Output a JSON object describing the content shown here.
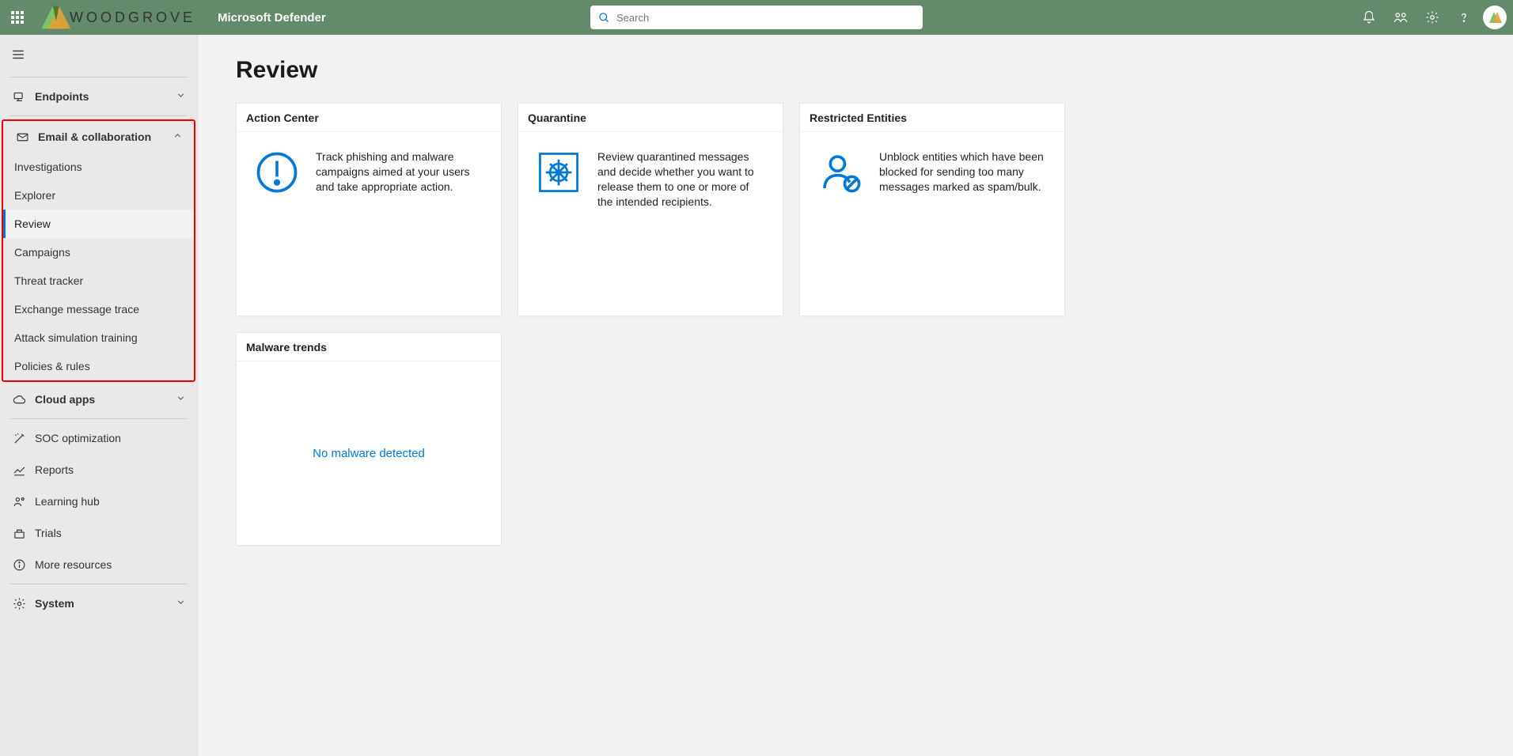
{
  "header": {
    "org": "WOODGROVE",
    "product": "Microsoft Defender",
    "search_placeholder": "Search"
  },
  "sidebar": {
    "endpoints": "Endpoints",
    "email_collab": "Email & collaboration",
    "sub": {
      "investigations": "Investigations",
      "explorer": "Explorer",
      "review": "Review",
      "campaigns": "Campaigns",
      "threat_tracker": "Threat tracker",
      "exchange_trace": "Exchange message trace",
      "attack_sim": "Attack simulation training",
      "policies": "Policies & rules"
    },
    "cloud_apps": "Cloud apps",
    "soc": "SOC optimization",
    "reports": "Reports",
    "learning": "Learning hub",
    "trials": "Trials",
    "more": "More resources",
    "system": "System"
  },
  "page": {
    "title": "Review"
  },
  "cards": {
    "action_center": {
      "title": "Action Center",
      "text": "Track phishing and malware campaigns aimed at your users and take appropriate action."
    },
    "quarantine": {
      "title": "Quarantine",
      "text": "Review quarantined messages and decide whether you want to release them to one or more of the intended recipients."
    },
    "restricted": {
      "title": "Restricted Entities",
      "text": "Unblock entities which have been blocked for sending too many messages marked as spam/bulk."
    },
    "malware": {
      "title": "Malware trends",
      "empty": "No malware detected"
    }
  }
}
